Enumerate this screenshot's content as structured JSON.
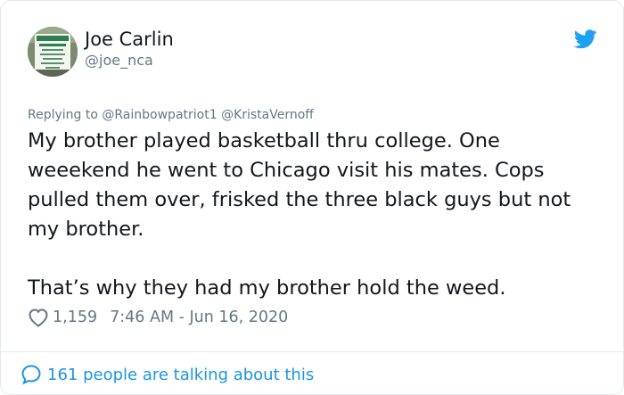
{
  "tweet": {
    "author": {
      "name": "Joe Carlin",
      "handle": "@joe_nca",
      "avatar_icon": "parking-sign-avatar"
    },
    "brand_icon": "twitter-bird-icon",
    "reply_prefix": "Replying to",
    "reply_mentions": "@Rainbowpatriot1 @KristaVernoff",
    "paragraph_1": "My brother played basketball thru college. One weeekend he went to Chicago visit his mates. Cops pulled them over, frisked the three black guys but not my brother.",
    "paragraph_2": "That’s why they had my brother hold the weed.",
    "likes": "1,159",
    "timestamp": "7:46 AM - Jun 16, 2020",
    "conversation": "161 people are talking about this"
  },
  "colors": {
    "brand_blue": "#1da1f2",
    "link_blue": "#1b95e0",
    "secondary_text": "#657786",
    "border": "#e1e8ed"
  }
}
